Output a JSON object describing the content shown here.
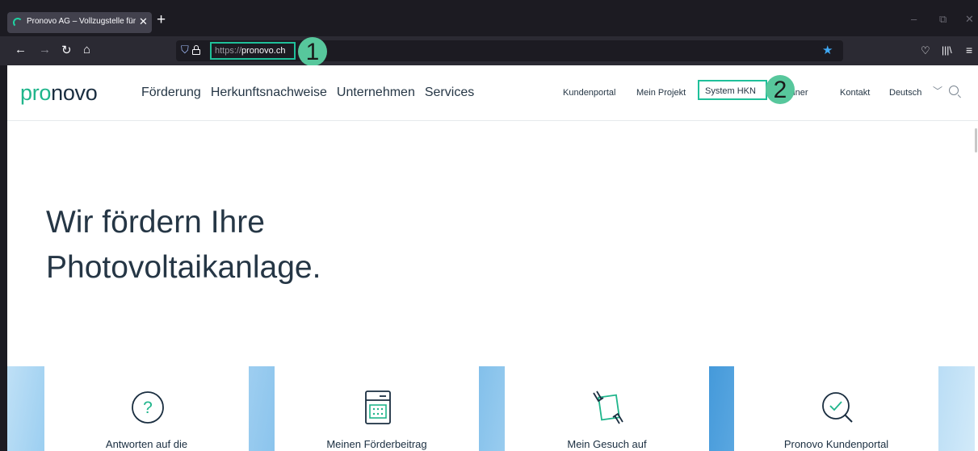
{
  "browser": {
    "tab_title": "Pronovo AG – Vollzugstelle für l",
    "tab_close": "✕",
    "new_tab": "+",
    "url_scheme": "https://",
    "url_domain": "pronovo.ch",
    "window_controls": [
      "–",
      "⧉",
      "✕"
    ]
  },
  "annotations": {
    "badge_1": "1",
    "badge_2": "2"
  },
  "site": {
    "logo_pro": "pro",
    "logo_novo": "novo",
    "main_nav": [
      "Förderung",
      "Herkunftsnachweise",
      "Unternehmen",
      "Services"
    ],
    "util_nav": {
      "kundenportal": "Kundenportal",
      "mein_projekt": "Mein Projekt",
      "system_hkn": "System HKN",
      "rechner": "Rechner",
      "kontakt": "Kontakt",
      "language": "Deutsch"
    },
    "hero_line1": "Wir fördern Ihre",
    "hero_line2": "Photovoltaikanlage.",
    "cards": [
      {
        "label": "Antworten auf die",
        "icon": "question-circle-icon"
      },
      {
        "label": "Meinen Förderbeitrag",
        "icon": "calculator-icon"
      },
      {
        "label": "Mein Gesuch auf",
        "icon": "hands-document-icon"
      },
      {
        "label": "Pronovo Kundenportal",
        "icon": "search-check-icon"
      }
    ]
  },
  "colors": {
    "highlight": "#1fc09a",
    "badge": "#57c79c",
    "brand_green": "#1fb58b",
    "brand_dark": "#1a2e40"
  }
}
